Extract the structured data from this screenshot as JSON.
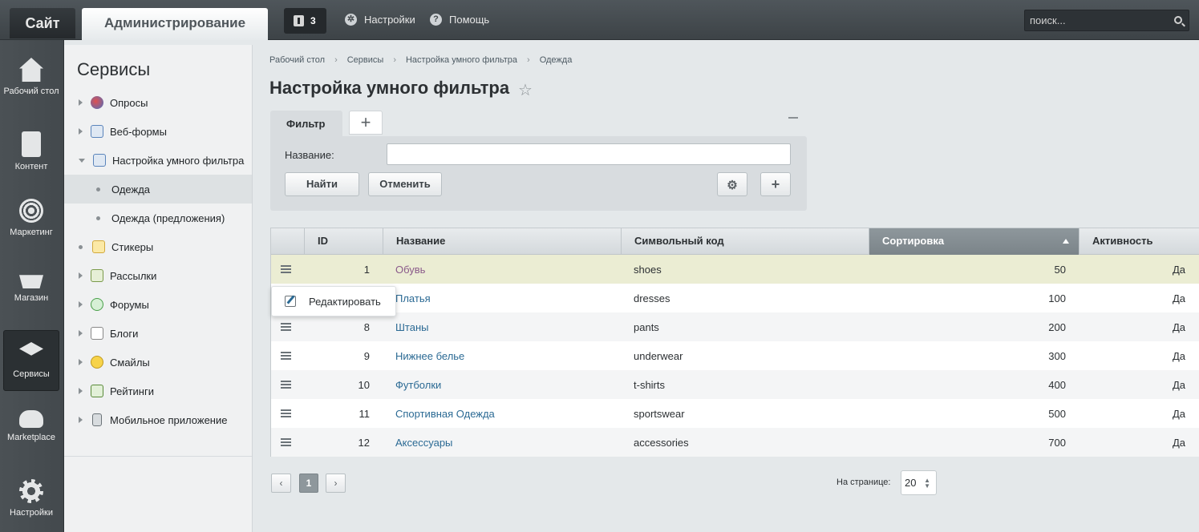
{
  "topbar": {
    "site_label": "Сайт",
    "admin_label": "Администрирование",
    "notifications_count": "3",
    "settings_label": "Настройки",
    "help_label": "Помощь",
    "search_placeholder": "поиск..."
  },
  "leftmenu": {
    "items": [
      {
        "label": "Рабочий стол",
        "icon": "home-icon"
      },
      {
        "label": "Контент",
        "icon": "document-icon"
      },
      {
        "label": "Маркетинг",
        "icon": "target-icon"
      },
      {
        "label": "Магазин",
        "icon": "basket-icon"
      },
      {
        "label": "Сервисы",
        "icon": "layers-icon",
        "active": true
      },
      {
        "label": "Marketplace",
        "icon": "cloud-download-icon"
      },
      {
        "label": "Настройки",
        "icon": "gear-icon"
      }
    ]
  },
  "services": {
    "title": "Сервисы",
    "items": [
      {
        "label": "Опросы",
        "icon": "poll-icon"
      },
      {
        "label": "Веб-формы",
        "icon": "form-icon"
      },
      {
        "label": "Настройка умного фильтра",
        "icon": "filter-icon",
        "expanded": true
      },
      {
        "label": "Одежда",
        "child": true,
        "selected": true
      },
      {
        "label": "Одежда (предложения)",
        "child": true
      },
      {
        "label": "Стикеры",
        "icon": "sticker-icon"
      },
      {
        "label": "Рассылки",
        "icon": "mail-icon"
      },
      {
        "label": "Форумы",
        "icon": "forum-icon"
      },
      {
        "label": "Блоги",
        "icon": "blog-icon"
      },
      {
        "label": "Смайлы",
        "icon": "smile-icon"
      },
      {
        "label": "Рейтинги",
        "icon": "rating-icon"
      },
      {
        "label": "Мобильное приложение",
        "icon": "mobile-icon"
      }
    ]
  },
  "breadcrumb": [
    "Рабочий стол",
    "Сервисы",
    "Настройка умного фильтра",
    "Одежда"
  ],
  "page_title": "Настройка умного фильтра",
  "filter": {
    "tab_label": "Фильтр",
    "name_label": "Название:",
    "name_value": "",
    "find_label": "Найти",
    "cancel_label": "Отменить"
  },
  "table": {
    "columns": [
      "ID",
      "Название",
      "Символьный код",
      "Сортировка",
      "Активность"
    ],
    "sorted_column": "Сортировка",
    "rows": [
      {
        "id": "1",
        "name": "Обувь",
        "code": "shoes",
        "sort": "50",
        "active": "Да"
      },
      {
        "id": "",
        "name": "Платья",
        "code": "dresses",
        "sort": "100",
        "active": "Да"
      },
      {
        "id": "8",
        "name": "Штаны",
        "code": "pants",
        "sort": "200",
        "active": "Да"
      },
      {
        "id": "9",
        "name": "Нижнее белье",
        "code": "underwear",
        "sort": "300",
        "active": "Да"
      },
      {
        "id": "10",
        "name": "Футболки",
        "code": "t-shirts",
        "sort": "400",
        "active": "Да"
      },
      {
        "id": "11",
        "name": "Спортивная Одежда",
        "code": "sportswear",
        "sort": "500",
        "active": "Да"
      },
      {
        "id": "12",
        "name": "Аксессуары",
        "code": "accessories",
        "sort": "700",
        "active": "Да"
      }
    ]
  },
  "context_menu": {
    "edit_label": "Редактировать"
  },
  "pagination": {
    "prev": "‹",
    "current": "1",
    "next": "›",
    "per_page_label": "На странице:",
    "per_page_value": "20"
  }
}
